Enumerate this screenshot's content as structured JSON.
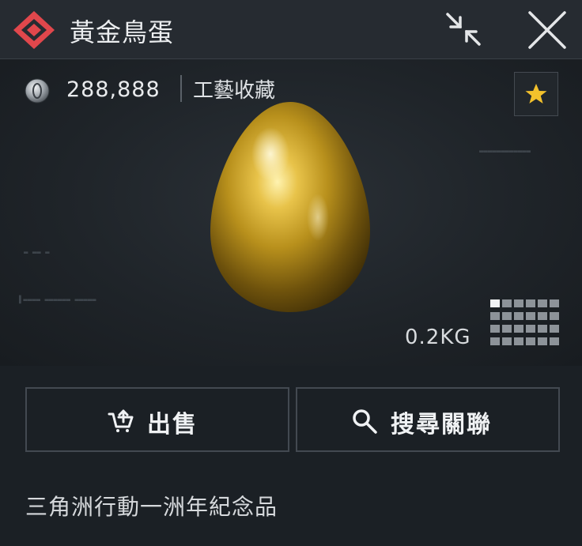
{
  "window": {
    "title": "黃金鳥蛋"
  },
  "item": {
    "price": "288,888",
    "category": "工藝收藏",
    "weight": "0.2KG",
    "description": "三角洲行動一洲年紀念品"
  },
  "actions": {
    "sell_label": "出售",
    "search_label": "搜尋關聯"
  },
  "icons": {
    "title": "diamond-emblem-icon",
    "collapse": "collapse-arrows-icon",
    "close": "close-icon",
    "currency": "silver-coin-icon",
    "favorite": "star-icon",
    "size": "inventory-grid-icon",
    "sell": "sell-cart-icon",
    "search": "magnifier-icon"
  },
  "colors": {
    "accent_red": "#e0474c",
    "star_gold": "#f3c12c",
    "egg_gold": "#c9a227"
  }
}
